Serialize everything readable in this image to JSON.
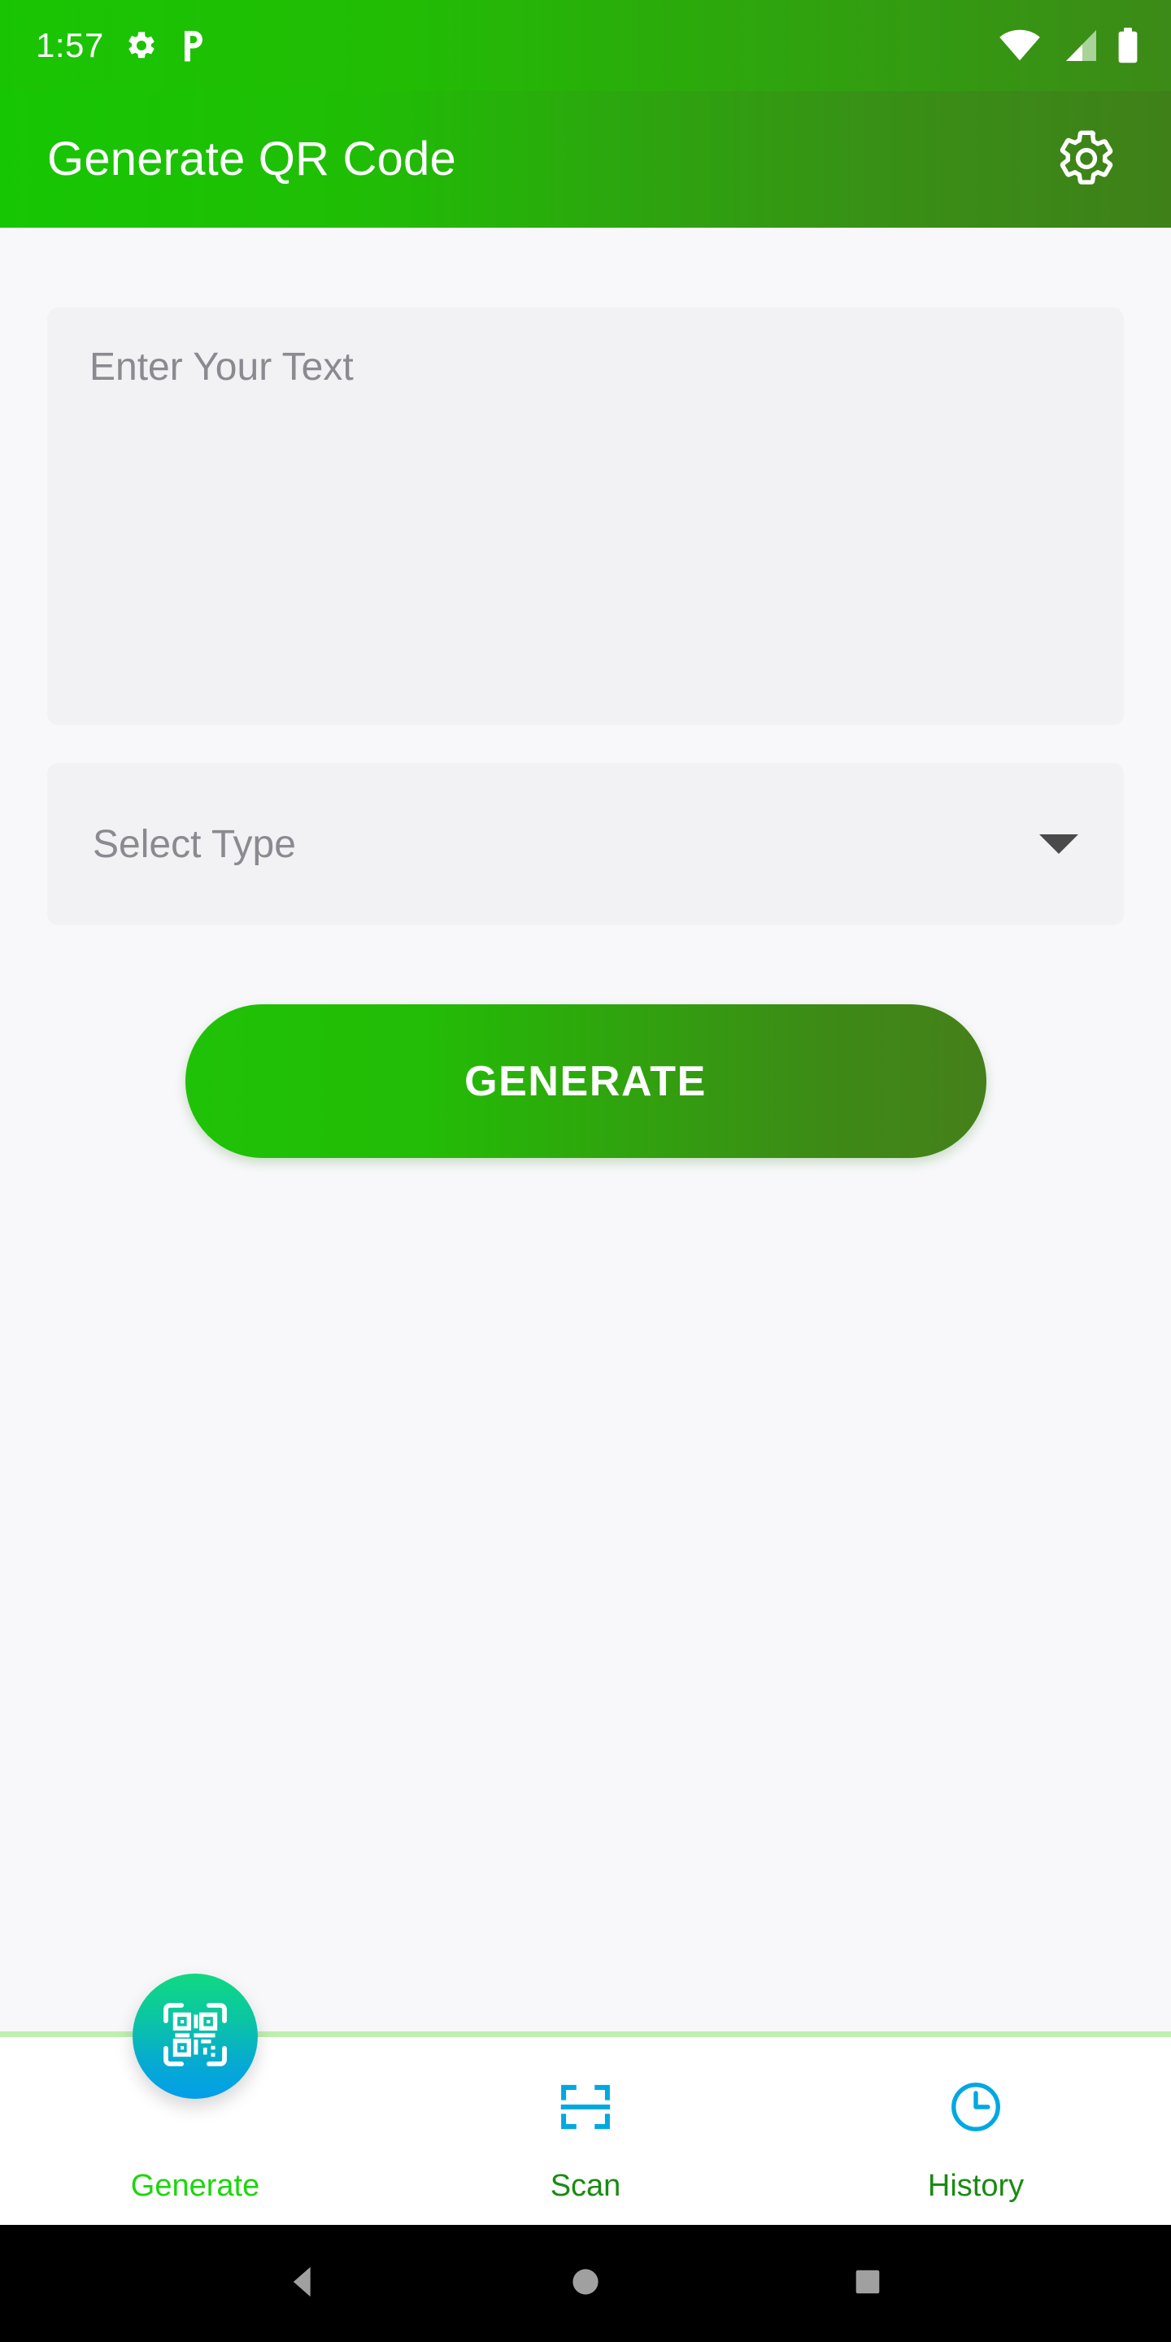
{
  "status_bar": {
    "time": "1:57",
    "icons_left": [
      "settings-gear-notification-icon",
      "p-app-notification-icon"
    ],
    "icons_right": [
      "wifi-icon",
      "cellular-signal-icon",
      "battery-icon"
    ],
    "background_color": "#19C503",
    "foreground_color": "#FFFFFF"
  },
  "app_bar": {
    "title": "Generate QR Code",
    "settings_icon": "gear-icon",
    "gradient_start": "#17C603",
    "gradient_end": "#3F8019",
    "title_color": "#FFFFFF"
  },
  "form": {
    "text_input": {
      "placeholder": "Enter Your Text",
      "value": "",
      "background_color": "#F2F1F4",
      "placeholder_color": "#8A8A90"
    },
    "type_select": {
      "placeholder": "Select Type",
      "value": "",
      "caret_icon": "chevron-down-icon",
      "background_color": "#F2F1F4",
      "placeholder_color": "#8A8A90"
    },
    "generate_button": {
      "label": "GENERATE",
      "gradient_start": "#1FC207",
      "gradient_end": "#45801A",
      "text_color": "#FFFFFF"
    }
  },
  "bottom_nav": {
    "divider_color": "#BFEFAF",
    "active_color": "#1DD60F",
    "inactive_color": "#1B8A13",
    "badge_gradient_start": "#10D982",
    "badge_gradient_end": "#039EEA",
    "icon_color": "#00A8E0",
    "items": [
      {
        "label": "Generate",
        "icon": "qr-code-icon",
        "active": true
      },
      {
        "label": "Scan",
        "icon": "scan-frame-icon",
        "active": false
      },
      {
        "label": "History",
        "icon": "clock-icon",
        "active": false
      }
    ]
  },
  "android_nav": {
    "background_color": "#000000",
    "icon_color": "#A0A0A0",
    "buttons": [
      {
        "name": "back",
        "icon": "back-triangle-icon"
      },
      {
        "name": "home",
        "icon": "home-circle-icon"
      },
      {
        "name": "recents",
        "icon": "recents-square-icon"
      }
    ]
  }
}
